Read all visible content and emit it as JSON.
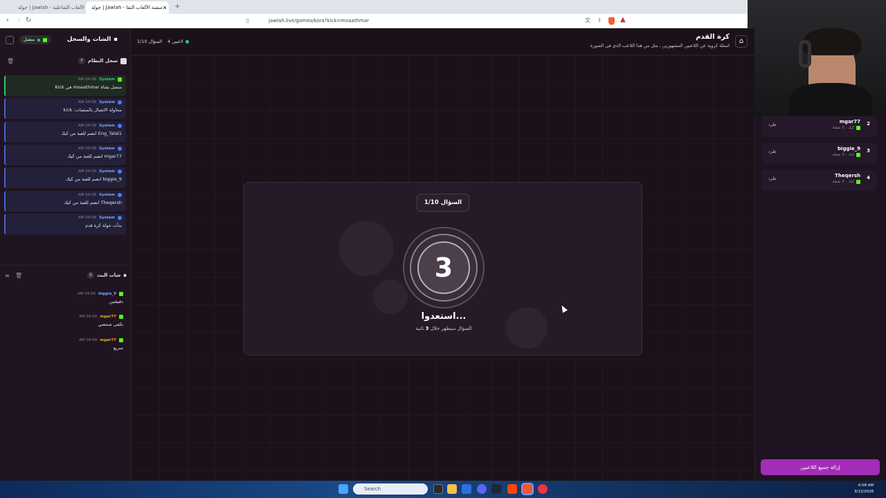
{
  "browser": {
    "tabs": [
      {
        "label": "جولة | Jawlah - منصة الألعاب التفاعلية"
      },
      {
        "label": "جولة | Jawlah - منصة الألعاب التفا"
      }
    ],
    "url": "jawlah.live/games/kora?kick=moaathmar"
  },
  "header": {
    "game_title": "كرة القدم",
    "game_subtitle": "اسئلة كروية عن اللاعبين المشهورين , مثل من هذا اللاعب الذي في الصورة",
    "players_count": "4 لاعبين",
    "question_counter": "السؤال 1/10"
  },
  "left_panel": {
    "title": "الشات والسجل",
    "status": "متصل",
    "system_log": {
      "title": "سجل النظام",
      "count": "7",
      "items": [
        {
          "name": "System",
          "time": "04:58 AM",
          "msg": "متصل بقناة moaathmar في Kick"
        },
        {
          "name": "System",
          "time": "04:58 AM",
          "msg": "محاولة الاتصال بالمنصات: kick"
        },
        {
          "name": "System",
          "time": "04:58 AM",
          "msg": "Eng_Talal1 انضم للعبة من كيك"
        },
        {
          "name": "System",
          "time": "04:58 AM",
          "msg": "mgar77 انضم للعبة من كيك"
        },
        {
          "name": "System",
          "time": "04:58 AM",
          "msg": "biggie_9 انضم للعبة من كيك"
        },
        {
          "name": "System",
          "time": "04:58 AM",
          "msg": "Theqersh انضم للعبة من كيك"
        },
        {
          "name": "System",
          "time": "04:58 AM",
          "msg": "بدأت جولة كرة قدم"
        }
      ]
    },
    "live_chat": {
      "title": "شات البث",
      "count": "3",
      "items": [
        {
          "name": "biggie_9",
          "time": "04:58 AM",
          "msg": "دقيقتين",
          "color": "#7ea4ff"
        },
        {
          "name": "mgar77",
          "time": "04:58 AM",
          "msg": "تكفى شجعني",
          "color": "#f5a623"
        },
        {
          "name": "mgar77",
          "time": "04:58 AM",
          "msg": "سريع",
          "color": "#f5a623"
        }
      ]
    }
  },
  "players": [
    {
      "rank": "2",
      "name": "mgar77",
      "meta": "كيك · 0 نقطة",
      "kick": "طرد"
    },
    {
      "rank": "3",
      "name": "biggie_9",
      "meta": "كيك · 0 نقطة",
      "kick": "طرد"
    },
    {
      "rank": "4",
      "name": "Theqersh",
      "meta": "كيك · 0 نقطة",
      "kick": "طرد"
    }
  ],
  "remove_all": "إزالة جميع اللاعبين",
  "countdown": {
    "pill": "السؤال 1/10",
    "number": "3",
    "title": "استعدوا...",
    "subtitle_pre": "السؤال سيظهر خلال",
    "subtitle_num": "3",
    "subtitle_post": "ثانية"
  },
  "taskbar": {
    "search_placeholder": "Search",
    "clock_time": "4:58 AM",
    "clock_date": "3/12/2026"
  },
  "colors": {
    "kick_green": "#53fc18",
    "accent_purple": "#a32db8"
  }
}
